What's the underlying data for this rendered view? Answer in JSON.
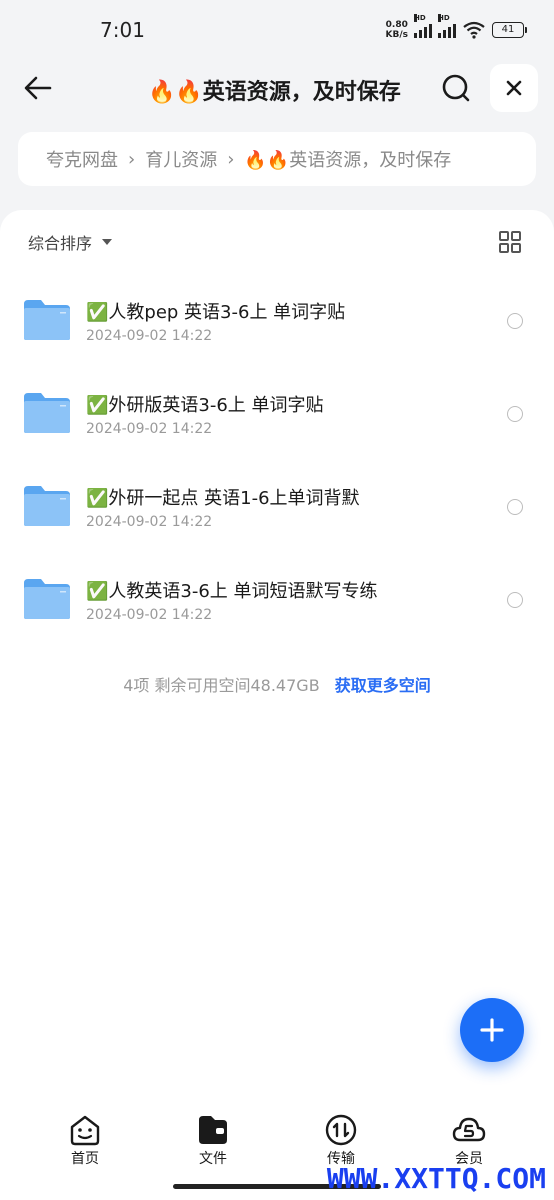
{
  "status": {
    "time": "7:01",
    "net_speed_value": "0.80",
    "net_speed_unit": "KB/s",
    "hd1": "HD",
    "hd2": "HD",
    "battery": "41"
  },
  "header": {
    "title": "🔥🔥英语资源，及时保存",
    "icons": [
      "back-arrow-icon",
      "search-icon",
      "close-icon"
    ]
  },
  "breadcrumb": {
    "items": [
      "夸克网盘",
      "育儿资源",
      "🔥🔥英语资源，及时保存"
    ],
    "separator": "›"
  },
  "toolbar": {
    "sort_label": "综合排序"
  },
  "files": [
    {
      "name": "✅人教pep 英语3-6上 单词字贴",
      "date": "2024-09-02 14:22"
    },
    {
      "name": "✅外研版英语3-6上 单词字贴",
      "date": "2024-09-02 14:22"
    },
    {
      "name": "✅外研一起点  英语1-6上单词背默",
      "date": "2024-09-02 14:22"
    },
    {
      "name": "✅人教英语3-6上 单词短语默写专练",
      "date": "2024-09-02 14:22"
    }
  ],
  "footer": {
    "summary": "4项 剩余可用空间48.47GB",
    "get_more": "获取更多空间"
  },
  "nav": {
    "home": "首页",
    "files": "文件",
    "transfer": "传输",
    "vip": "会员"
  },
  "watermark": "WWW.XXTTQ.COM",
  "colors": {
    "accent": "#1c6ef7",
    "link": "#2a6df4",
    "folder": "#6fb2f5",
    "background": "#f3f4f6"
  }
}
